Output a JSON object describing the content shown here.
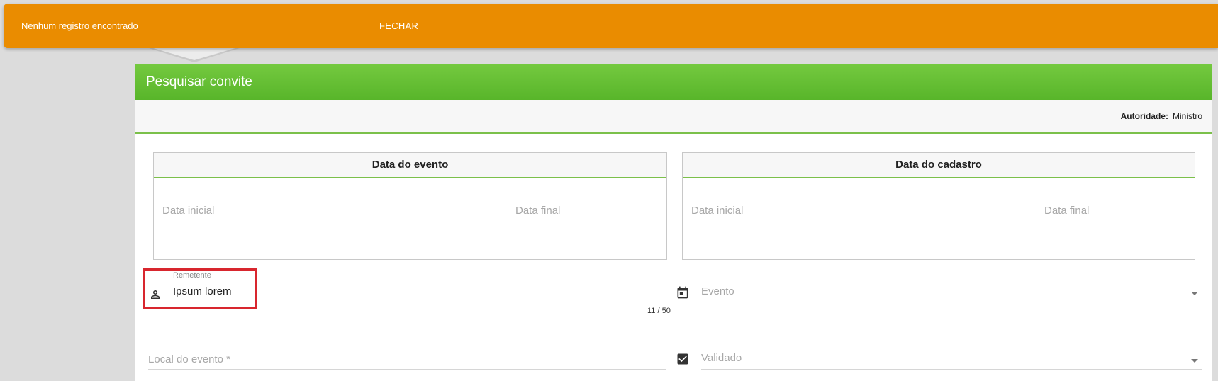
{
  "snackbar": {
    "message": "Nenhum registro encontrado",
    "action": "FECHAR",
    "color": "#ea8c00"
  },
  "panel": {
    "title": "Pesquisar convite",
    "header_color": "#5fba2f",
    "authority_label": "Autoridade:",
    "authority_value": "Ministro"
  },
  "event_date": {
    "title": "Data do evento",
    "start_placeholder": "Data inicial",
    "end_placeholder": "Data final"
  },
  "register_date": {
    "title": "Data do cadastro",
    "start_placeholder": "Data inicial",
    "end_placeholder": "Data final"
  },
  "sender": {
    "label": "Remetente",
    "value": "Ipsum lorem",
    "counter": "11 / 50",
    "icon": "person-icon"
  },
  "event": {
    "placeholder": "Evento",
    "icon": "calendar-icon"
  },
  "location": {
    "placeholder": "Local do evento *"
  },
  "validated": {
    "placeholder": "Validado",
    "icon": "checkbox-checked-icon"
  }
}
